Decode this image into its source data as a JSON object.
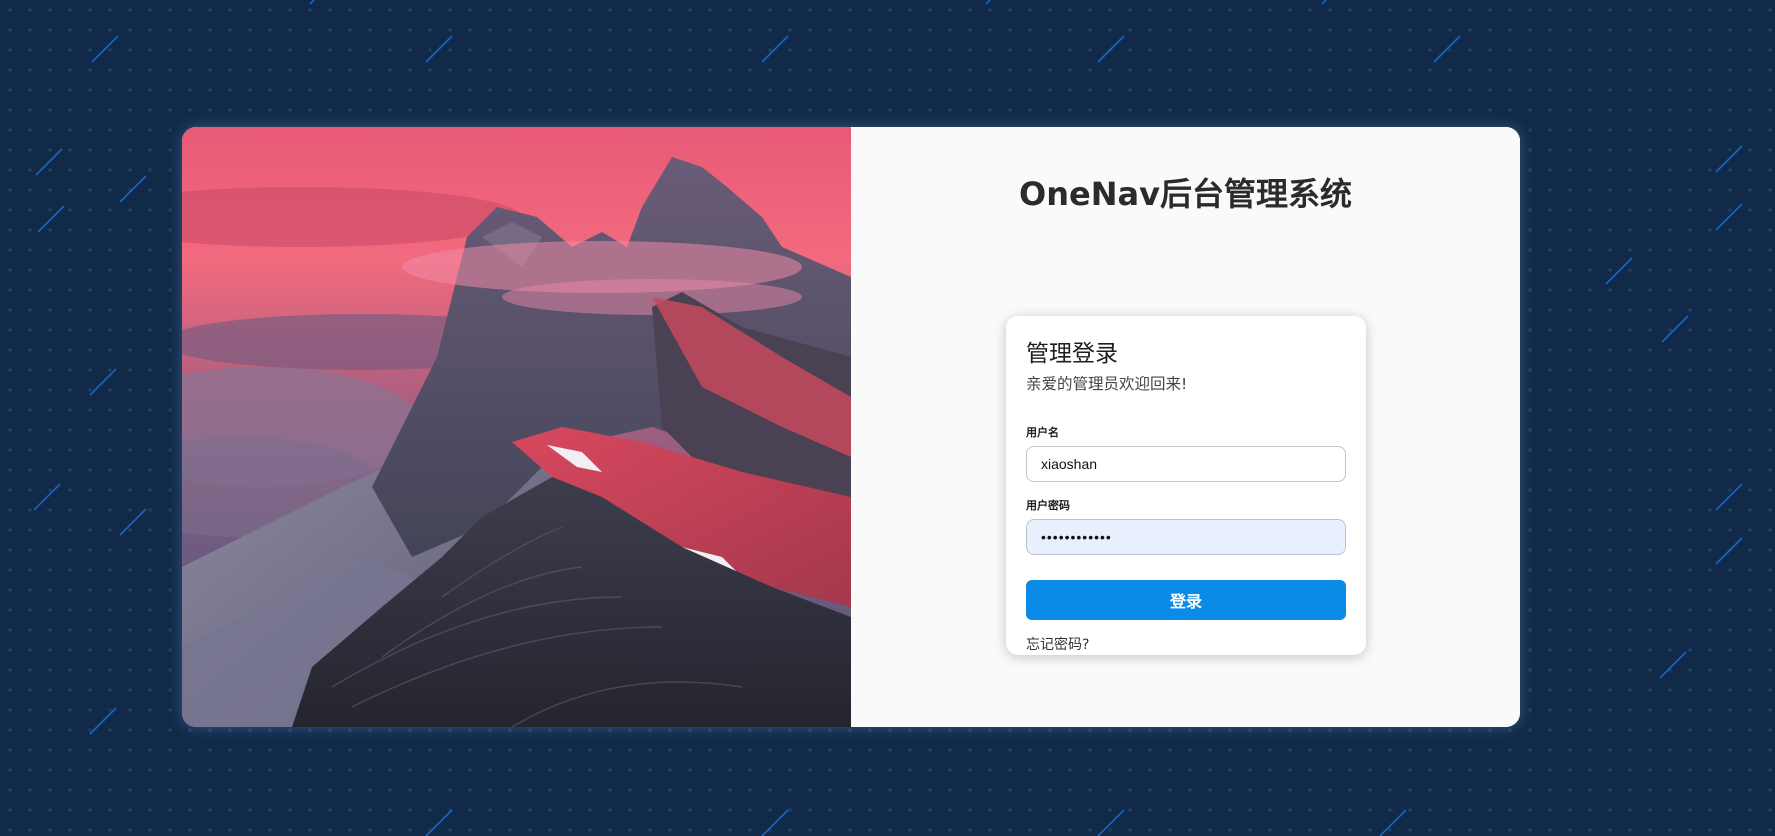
{
  "header": {
    "title": "OneNav后台管理系统"
  },
  "login_form": {
    "heading": "管理登录",
    "subtitle": "亲爱的管理员欢迎回来!",
    "username_label": "用户名",
    "username_value": "xiaoshan",
    "password_label": "用户密码",
    "password_value": "••••••••••••",
    "submit_label": "登录",
    "forgot_label": "忘记密码?"
  },
  "hero_image": {
    "description_icon": "mountain-landscape-image"
  },
  "colors": {
    "page_background": "#112a49",
    "accent": "#0b8be8",
    "panel_background": "#fafafa",
    "autofill_background": "#e8f0fe"
  }
}
